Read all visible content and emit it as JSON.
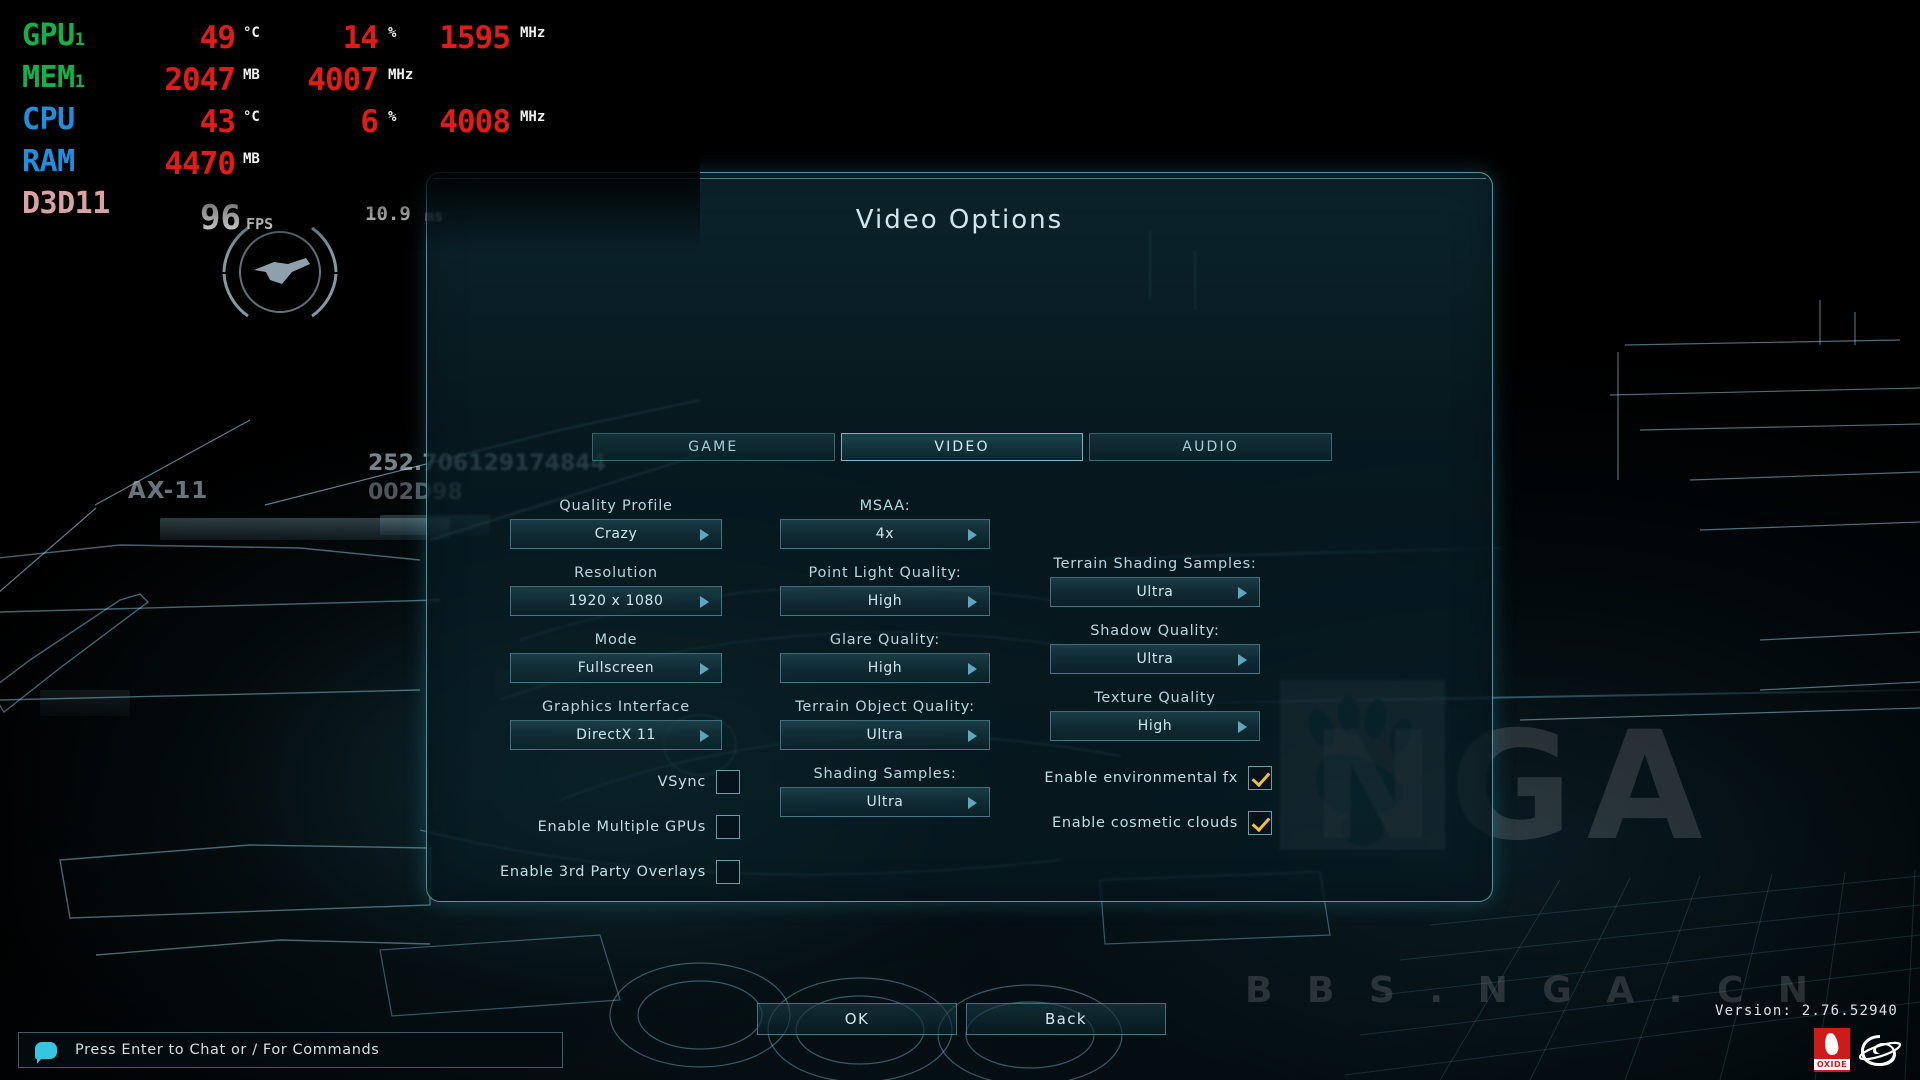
{
  "hw_overlay": {
    "rows": [
      {
        "label": "GPU",
        "sub": "1",
        "color": "#12b24a",
        "v1": "49",
        "u1": "°C",
        "v2": "14",
        "u2": "%",
        "v3": "1595",
        "u3": "MHz"
      },
      {
        "label": "MEM",
        "sub": "1",
        "color": "#12b24a",
        "v1": "2047",
        "u1": "MB",
        "v2": "4007",
        "u2": "MHz",
        "v3": "",
        "u3": ""
      },
      {
        "label": "CPU",
        "sub": "",
        "color": "#1f8fe0",
        "v1": "43",
        "u1": "°C",
        "v2": "6",
        "u2": "%",
        "v3": "4008",
        "u3": "MHz"
      },
      {
        "label": "RAM",
        "sub": "",
        "color": "#1f8fe0",
        "v1": "4470",
        "u1": "MB",
        "v2": "",
        "u2": "",
        "v3": "",
        "u3": ""
      }
    ],
    "api_label": "D3D11",
    "fps_value": "96",
    "fps_unit": "FPS",
    "frametime_value": "10.9",
    "frametime_unit": "ms",
    "value_color": "#e01b18",
    "unit_color": "#f2f2f2"
  },
  "scene": {
    "vehicle_tag": "AX-11",
    "coord_readout": "252.706129174844",
    "id_readout": "002D98"
  },
  "watermark": {
    "brand": "NGA",
    "url": "B B S . N G A . C N",
    "paw_icon": "bear-paw-icon"
  },
  "dialog": {
    "title": "Video Options",
    "tabs": [
      {
        "label": "GAME",
        "active": false,
        "name": "tab-game"
      },
      {
        "label": "VIDEO",
        "active": true,
        "name": "tab-video"
      },
      {
        "label": "AUDIO",
        "active": false,
        "name": "tab-audio"
      }
    ],
    "column_left": [
      {
        "name": "quality-profile",
        "label": "Quality Profile",
        "value": "Crazy"
      },
      {
        "name": "resolution",
        "label": "Resolution",
        "value": "1920 x 1080"
      },
      {
        "name": "mode",
        "label": "Mode",
        "value": "Fullscreen"
      },
      {
        "name": "graphics-interface",
        "label": "Graphics Interface",
        "value": "DirectX 11"
      }
    ],
    "column_left_checkboxes": [
      {
        "name": "vsync",
        "label": "VSync",
        "checked": false
      },
      {
        "name": "enable-multiple-gpus",
        "label": "Enable Multiple GPUs",
        "checked": false
      },
      {
        "name": "enable-3rd-party-overlays",
        "label": "Enable 3rd Party Overlays",
        "checked": false
      }
    ],
    "column_mid": [
      {
        "name": "msaa",
        "label": "MSAA:",
        "value": "4x"
      },
      {
        "name": "point-light-quality",
        "label": "Point Light Quality:",
        "value": "High"
      },
      {
        "name": "glare-quality",
        "label": "Glare Quality:",
        "value": "High"
      },
      {
        "name": "terrain-object-quality",
        "label": "Terrain Object Quality:",
        "value": "Ultra"
      },
      {
        "name": "shading-samples",
        "label": "Shading Samples:",
        "value": "Ultra"
      }
    ],
    "column_right": [
      {
        "name": "terrain-shading-samples",
        "label": "Terrain Shading Samples:",
        "value": "Ultra"
      },
      {
        "name": "shadow-quality",
        "label": "Shadow Quality:",
        "value": "Ultra"
      },
      {
        "name": "texture-quality",
        "label": "Texture Quality",
        "value": "High"
      }
    ],
    "column_right_checkboxes": [
      {
        "name": "enable-environmental-fx",
        "label": "Enable environmental fx",
        "checked": true
      },
      {
        "name": "enable-cosmetic-clouds",
        "label": "Enable cosmetic clouds",
        "checked": true
      }
    ],
    "buttons": [
      {
        "name": "ok-button",
        "label": "OK"
      },
      {
        "name": "back-button",
        "label": "Back"
      }
    ],
    "accent_color": "#78d7eb",
    "checkmark_color": "#e8c14a"
  },
  "chat": {
    "icon": "speech-bubble-icon",
    "hint": "Press Enter to Chat or / For Commands"
  },
  "footer": {
    "version": "Version: 2.76.52940",
    "logo_oxide": "OXIDE",
    "logo_stardock": "stardock-logo"
  }
}
